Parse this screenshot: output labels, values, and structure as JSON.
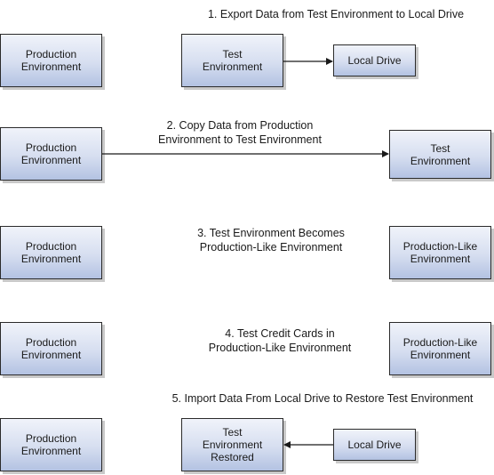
{
  "steps": [
    {
      "label": "1. Export Data from Test Environment to Local Drive",
      "nodes": [
        "Production Environment",
        "Test Environment",
        "Local Drive"
      ],
      "edges": [
        {
          "from": "Test Environment",
          "to": "Local Drive"
        }
      ]
    },
    {
      "label_lines": [
        "2. Copy Data from Production",
        "Environment to Test Environment"
      ],
      "nodes": [
        "Production Environment",
        "Test Environment"
      ],
      "edges": [
        {
          "from": "Production Environment",
          "to": "Test Environment"
        }
      ]
    },
    {
      "label_lines": [
        "3. Test Environment Becomes",
        "Production-Like Environment"
      ],
      "nodes": [
        "Production Environment",
        "Production-Like Environment"
      ],
      "edges": []
    },
    {
      "label_lines": [
        "4. Test Credit Cards in",
        "Production-Like Environment"
      ],
      "nodes": [
        "Production Environment",
        "Production-Like Environment"
      ],
      "edges": []
    },
    {
      "label": "5. Import Data From Local Drive to Restore Test Environment",
      "nodes": [
        "Production Environment",
        "Test Environment Restored",
        "Local Drive"
      ],
      "edges": [
        {
          "from": "Local Drive",
          "to": "Test Environment Restored"
        }
      ]
    }
  ],
  "text": {
    "prod_1": "Production",
    "prod_2": "Environment",
    "test_1": "Test",
    "test_2": "Environment",
    "local": "Local Drive",
    "plike_1": "Production-Like",
    "plike_2": "Environment",
    "restored_3": "Restored"
  }
}
